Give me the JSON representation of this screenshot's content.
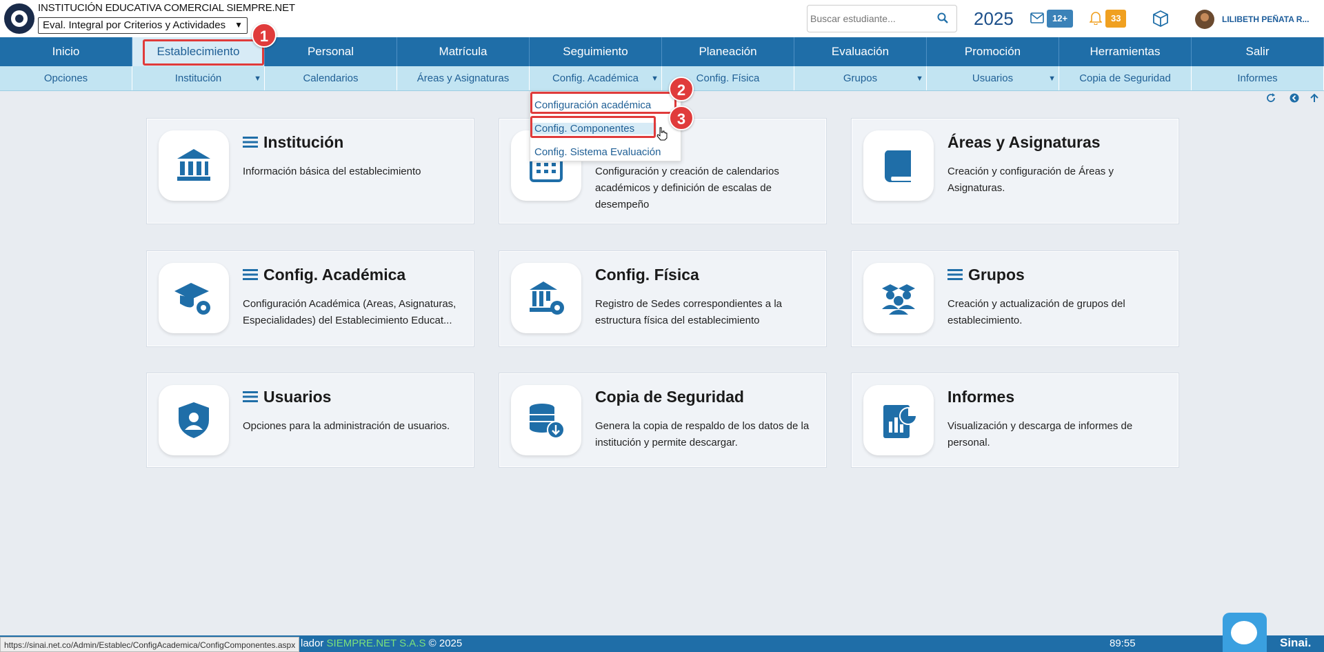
{
  "header": {
    "institution": "INSTITUCIÓN EDUCATIVA COMERCIAL SIEMPRE.NET",
    "eval_select": "Eval. Integral por Criterios y Actividades",
    "search_placeholder": "Buscar estudiante...",
    "year": "2025",
    "mail_badge": "12+",
    "notif_badge": "33",
    "user_name": "LILIBETH PEÑATA R..."
  },
  "main_nav": [
    "Inicio",
    "Establecimiento",
    "Personal",
    "Matrícula",
    "Seguimiento",
    "Planeación",
    "Evaluación",
    "Promoción",
    "Herramientas",
    "Salir"
  ],
  "sub_nav": [
    {
      "label": "Opciones",
      "caret": ""
    },
    {
      "label": "Institución",
      "caret": "▼"
    },
    {
      "label": "Calendarios",
      "caret": ""
    },
    {
      "label": "Áreas y Asignaturas",
      "caret": ""
    },
    {
      "label": "Config. Académica",
      "caret": "▼"
    },
    {
      "label": "Config. Física",
      "caret": ""
    },
    {
      "label": "Grupos",
      "caret": "▼"
    },
    {
      "label": "Usuarios",
      "caret": "▼"
    },
    {
      "label": "Copia de Seguridad",
      "caret": ""
    },
    {
      "label": "Informes",
      "caret": ""
    }
  ],
  "dropdown": [
    "Configuración académica",
    "Config. Componentes",
    "Config. Sistema Evaluación"
  ],
  "markers": [
    "1",
    "2",
    "3"
  ],
  "cards": [
    {
      "title": "Institución",
      "desc": "Información básica del establecimiento",
      "icon": "bank-icon",
      "menu": true
    },
    {
      "title": "",
      "desc": "Configuración y creación de calendarios académicos y definición de escalas de desempeño",
      "icon": "calendar-icon",
      "menu": false
    },
    {
      "title": "Áreas y Asignaturas",
      "desc": "Creación y configuración de Áreas y Asignaturas.",
      "icon": "book-icon",
      "menu": false
    },
    {
      "title": "Config. Académica",
      "desc": "Configuración Académica (Areas, Asignaturas, Especialidades) del Establecimiento Educat...",
      "icon": "graduation-gear-icon",
      "menu": true
    },
    {
      "title": "Config. Física",
      "desc": "Registro de Sedes correspondientes a la estructura física del establecimiento",
      "icon": "building-gear-icon",
      "menu": false
    },
    {
      "title": "Grupos",
      "desc": "Creación y actualización de grupos del establecimiento.",
      "icon": "group-icon",
      "menu": true
    },
    {
      "title": "Usuarios",
      "desc": "Opciones para la administración de usuarios.",
      "icon": "shield-user-icon",
      "menu": true
    },
    {
      "title": "Copia de Seguridad",
      "desc": "Genera la copia de respaldo de los datos de la institución y permite descargar.",
      "icon": "database-download-icon",
      "menu": false
    },
    {
      "title": "Informes",
      "desc": "Visualización y descarga de informes de personal.",
      "icon": "report-icon",
      "menu": false
    }
  ],
  "footer": {
    "url": "https://sinai.net.co/Admin/Establec/ConfigAcademica/ConfigComponentes.aspx",
    "text_prefix": "lador",
    "brand": "SIEMPRE.NET S.A.S",
    "copyright": "© 2025",
    "timer": "89:55",
    "logo": "Sinai."
  },
  "colors": {
    "primary": "#1f6ea8",
    "subnav": "#c2e4f2",
    "highlight": "#e03b3b",
    "icon": "#1f6ea8"
  }
}
